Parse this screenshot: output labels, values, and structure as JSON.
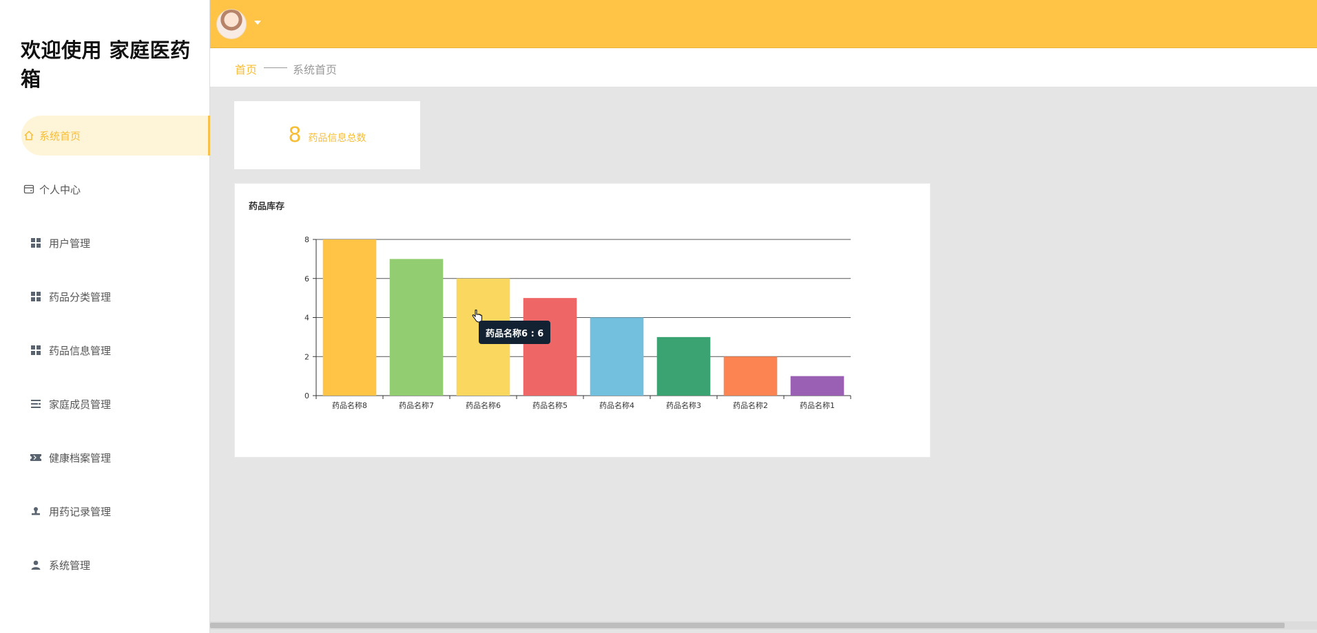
{
  "app": {
    "title": "欢迎使用 家庭医药箱"
  },
  "sidebar": {
    "items": [
      {
        "label": "系统首页",
        "icon": "home-icon",
        "active": true
      },
      {
        "label": "个人中心",
        "icon": "wallet-icon"
      },
      {
        "label": "用户管理",
        "icon": "grid-icon"
      },
      {
        "label": "药品分类管理",
        "icon": "grid-icon"
      },
      {
        "label": "药品信息管理",
        "icon": "grid-icon"
      },
      {
        "label": "家庭成员管理",
        "icon": "list-icon"
      },
      {
        "label": "健康档案管理",
        "icon": "ticket-icon"
      },
      {
        "label": "用药记录管理",
        "icon": "stamp-icon"
      },
      {
        "label": "系统管理",
        "icon": "user-icon"
      }
    ]
  },
  "breadcrumb": {
    "home": "首页",
    "current": "系统首页"
  },
  "stat": {
    "value": "8",
    "label": "药品信息总数"
  },
  "chart_card": {
    "title": "药品库存"
  },
  "tooltip": {
    "text": "药品名称6 : 6"
  },
  "colors": {
    "accent": "#ffc445",
    "accent_text": "#f7bd35"
  },
  "chart_data": {
    "type": "bar",
    "categories": [
      "药品名称8",
      "药品名称7",
      "药品名称6",
      "药品名称5",
      "药品名称4",
      "药品名称3",
      "药品名称2",
      "药品名称1"
    ],
    "values": [
      8,
      7,
      6,
      5,
      4,
      3,
      2,
      1
    ],
    "colors": [
      "#ffc445",
      "#93cd71",
      "#fad860",
      "#ee6666",
      "#73c0de",
      "#3ba272",
      "#fc8452",
      "#9a60b4"
    ],
    "yticks": [
      0,
      2,
      4,
      6,
      8
    ],
    "ylim": [
      0,
      8
    ],
    "grid": true,
    "title": "药品库存"
  }
}
